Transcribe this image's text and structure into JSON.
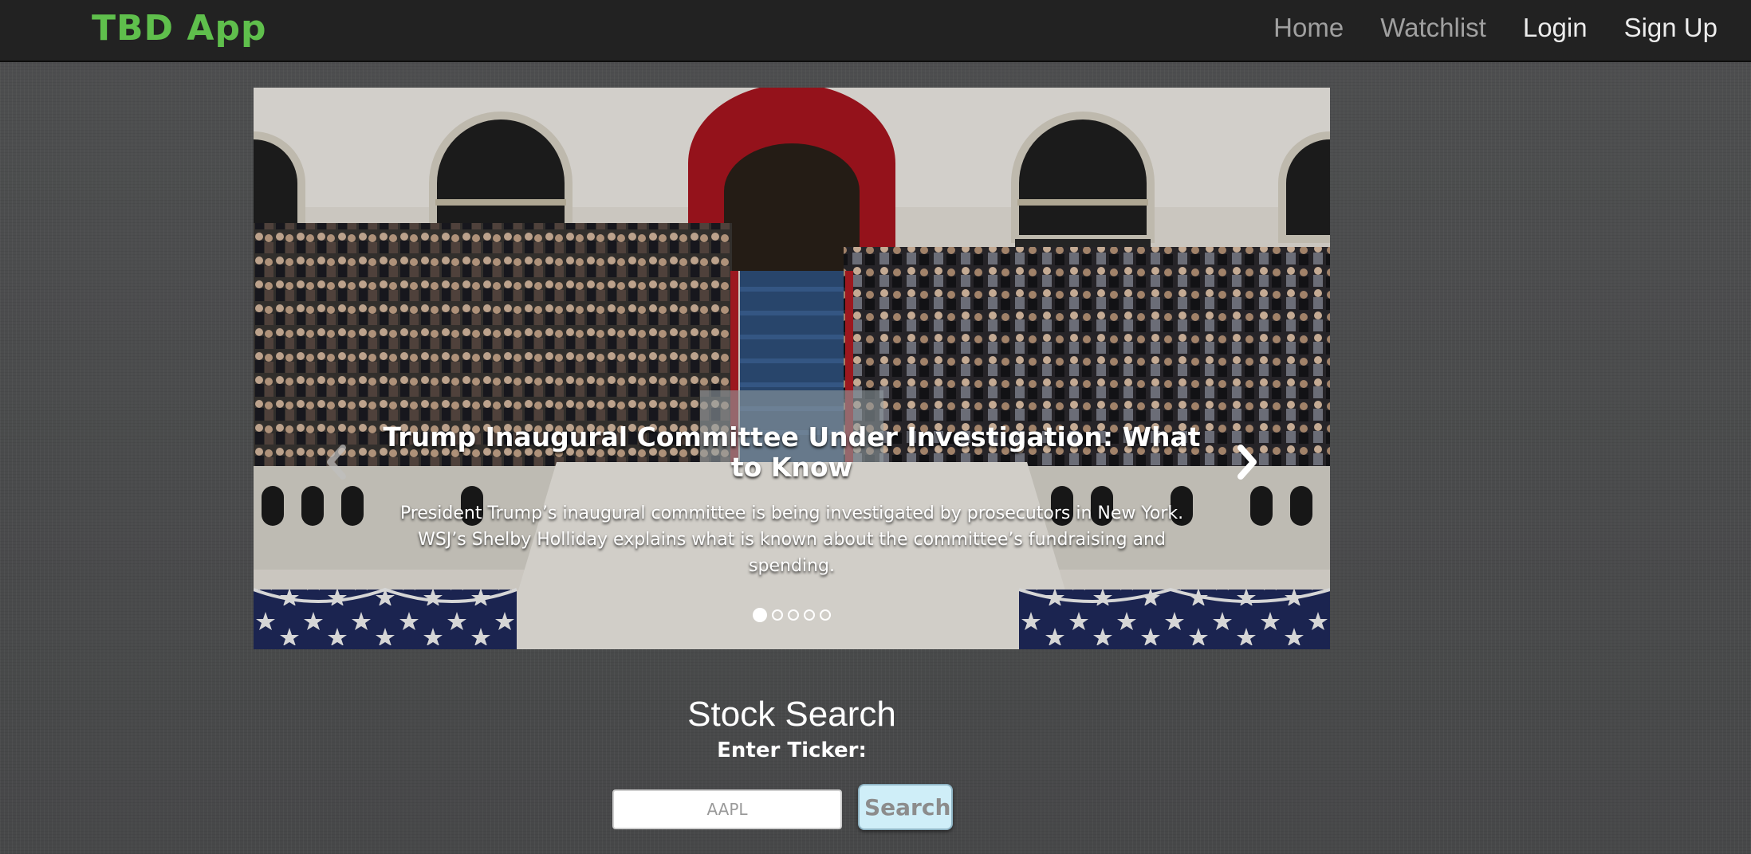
{
  "navbar": {
    "brand": "TBD App",
    "links": [
      {
        "label": "Home"
      },
      {
        "label": "Watchlist"
      },
      {
        "label": "Login"
      },
      {
        "label": "Sign Up"
      }
    ]
  },
  "carousel": {
    "slide": {
      "title": "Trump Inaugural Committee Under Investigation: What to Know",
      "text": "President Trump’s inaugural committee is being investigated by prosecutors in New York. WSJ’s Shelby Holliday explains what is known about the committee’s fundraising and spending."
    },
    "active_index": 0,
    "indicator_count": 5,
    "prev_icon": "chevron-left-icon",
    "next_icon": "chevron-right-icon"
  },
  "search": {
    "title": "Stock Search",
    "label": "Enter Ticker:",
    "placeholder": "AAPL",
    "value": "",
    "button_label": "Search"
  },
  "colors": {
    "brand": "#5fbf4c",
    "navbar_bg": "#222222",
    "page_bg": "#4b4c4d",
    "button_bg": "#cfeef8"
  }
}
